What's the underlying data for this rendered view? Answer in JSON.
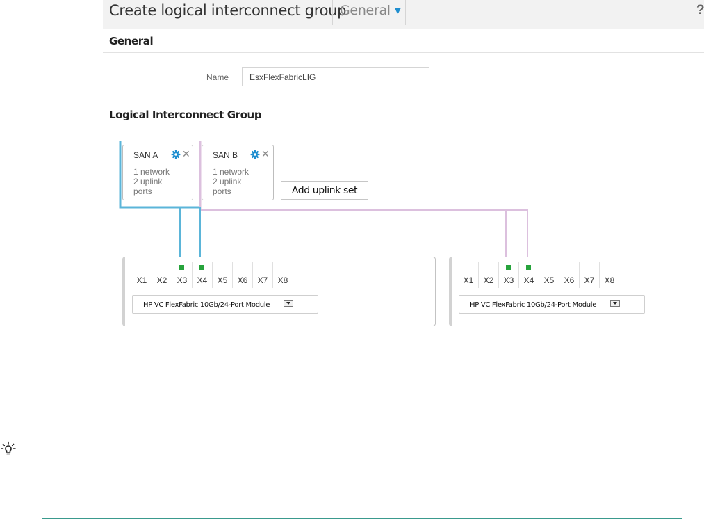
{
  "header": {
    "title": "Create logical interconnect group",
    "section_selector": "General",
    "help": "?"
  },
  "general": {
    "heading": "General",
    "name_label": "Name",
    "name_value": "EsxFlexFabricLIG"
  },
  "lig": {
    "heading": "Logical Interconnect Group",
    "uplink_sets": [
      {
        "name": "SAN A",
        "line1": "1 network",
        "line2": "2 uplink",
        "line3": "ports",
        "color": "#5bb5d9"
      },
      {
        "name": "SAN B",
        "line1": "1 network",
        "line2": "2 uplink",
        "line3": "ports",
        "color": "#dcc0de"
      }
    ],
    "add_uplink_label": "Add uplink set",
    "bays": [
      {
        "ports": [
          "X1",
          "X2",
          "X3",
          "X4",
          "X5",
          "X6",
          "X7",
          "X8"
        ],
        "active_ports": [
          "X3",
          "X4"
        ],
        "module": "HP VC FlexFabric 10Gb/24-Port Module"
      },
      {
        "ports": [
          "X1",
          "X2",
          "X3",
          "X4",
          "X5",
          "X6",
          "X7",
          "X8"
        ],
        "active_ports": [
          "X3",
          "X4"
        ],
        "module": "HP VC FlexFabric 10Gb/24-Port Module"
      }
    ]
  },
  "colors": {
    "accent": "#1f8ecf",
    "port_active": "#27a33c",
    "tip_rule": "#3a9a8d"
  },
  "tip": {
    "icon": "lightbulb-icon"
  }
}
